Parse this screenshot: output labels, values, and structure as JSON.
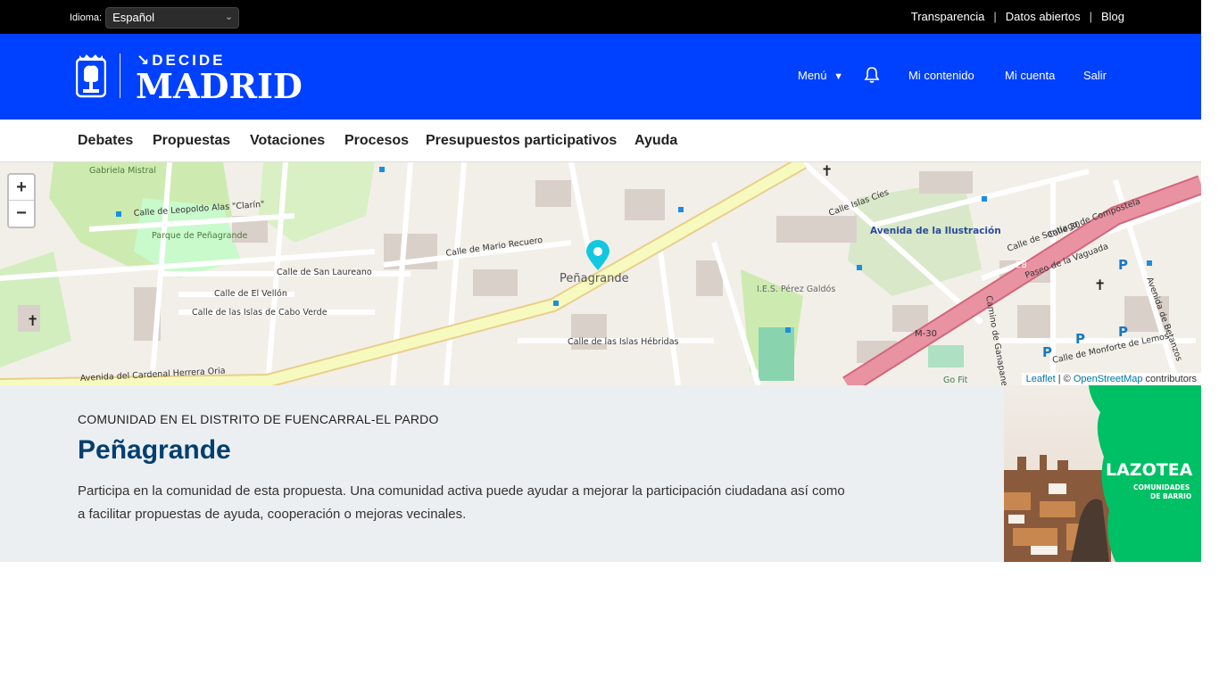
{
  "topbar": {
    "language_label": "Idioma:",
    "language_value": "Español",
    "links": [
      "Transparencia",
      "Datos abiertos",
      "Blog"
    ]
  },
  "header": {
    "logo_top": "DECIDE",
    "logo_main": "MADRID",
    "menu_label": "Menú",
    "my_content": "Mi contenido",
    "my_account": "Mi cuenta",
    "logout": "Salir"
  },
  "mainnav": {
    "items": [
      "Debates",
      "Propuestas",
      "Votaciones",
      "Procesos",
      "Presupuestos participativos",
      "Ayuda"
    ]
  },
  "map": {
    "zoom_in": "+",
    "zoom_out": "−",
    "attribution_leaflet": "Leaflet",
    "attribution_sep": " | © ",
    "attribution_osm": "OpenStreetMap",
    "attribution_tail": " contributors",
    "marker_label": "Peñagrande",
    "streets": {
      "s1": "Calle de Leopoldo Alas \"Clarín\"",
      "s2": "Parque de Peñagrande",
      "s3": "Calle de San Laureano",
      "s4": "Calle de El Vellón",
      "s5": "Calle de las Islas de Cabo Verde",
      "s6": "Calle de Mario Recuero",
      "s7": "Avenida del Cardenal Herrera Oria",
      "s8": "Calle de las Islas Hébridas",
      "s9": "Avenida de la Ilustración",
      "s10": "Calle 30",
      "s11": "M-30",
      "s12": "Calle Islas Cíes",
      "s13": "I.E.S. Pérez Galdós",
      "s14": "Calle de Santiago de Compostela",
      "s15": "Paseo de la Vaguada",
      "s16": "Calle de Monforte de Lemos",
      "s17": "Go Fit",
      "s18": "Gabriela Mistral",
      "s19": "Avenida de Betanzos",
      "s20": "Camino de Ganapanes",
      "s21": "28"
    }
  },
  "community": {
    "kicker": "COMUNIDAD EN EL DISTRITO DE FUENCARRAL-EL PARDO",
    "title": "Peñagrande",
    "description": "Participa en la comunidad de esta propuesta. Una comunidad activa puede ayudar a mejorar la participación ciudadana así como a facilitar propuestas de ayuda, cooperación o mejoras vecinales."
  },
  "promo": {
    "title": "LAZOTEA",
    "subtitle1": "COMUNIDADES",
    "subtitle2": "DE BARRIO"
  },
  "colors": {
    "header_blue": "#0040ff",
    "title_blue": "#003f6f",
    "promo_green": "#00c065",
    "marker_cyan": "#12c8e0"
  }
}
